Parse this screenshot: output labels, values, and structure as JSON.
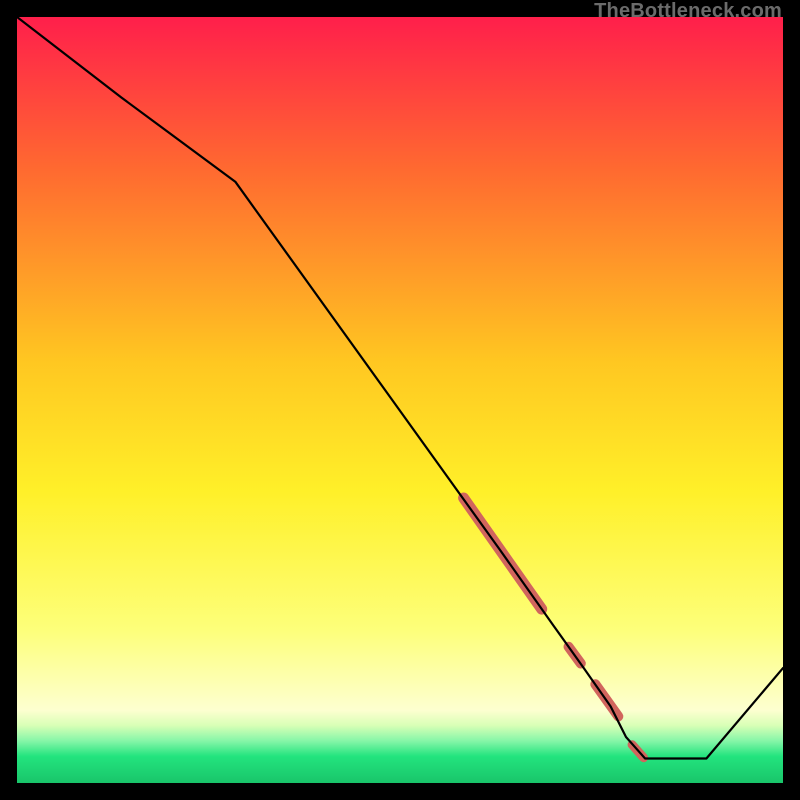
{
  "watermark": "TheBottleneck.com",
  "chart_data": {
    "type": "line",
    "title": "",
    "xlabel": "",
    "ylabel": "",
    "xlim": [
      0,
      100
    ],
    "ylim": [
      0,
      100
    ],
    "gradient_stops": [
      {
        "offset": 0.0,
        "color": "#ff1f4b"
      },
      {
        "offset": 0.2,
        "color": "#ff6a30"
      },
      {
        "offset": 0.45,
        "color": "#ffc721"
      },
      {
        "offset": 0.62,
        "color": "#fff029"
      },
      {
        "offset": 0.8,
        "color": "#fdff7a"
      },
      {
        "offset": 0.905,
        "color": "#fdffd0"
      },
      {
        "offset": 0.925,
        "color": "#d8ffb6"
      },
      {
        "offset": 0.945,
        "color": "#86f6a8"
      },
      {
        "offset": 0.965,
        "color": "#23e47e"
      },
      {
        "offset": 1.0,
        "color": "#19c56a"
      }
    ],
    "series": [
      {
        "name": "bottleneck-curve",
        "x": [
          0.0,
          13.6,
          28.5,
          63.0,
          70.0,
          74.0,
          77.5,
          79.5,
          82.0,
          90.0,
          100.0
        ],
        "y": [
          100.0,
          89.5,
          78.5,
          30.5,
          20.6,
          15.0,
          10.0,
          6.0,
          3.2,
          3.2,
          15.0
        ]
      }
    ],
    "highlights": [
      {
        "x1": 58.3,
        "y1": 37.2,
        "x2": 68.5,
        "y2": 22.7,
        "width": 11
      },
      {
        "x1": 72.0,
        "y1": 17.8,
        "x2": 73.6,
        "y2": 15.6,
        "width": 10
      },
      {
        "x1": 75.5,
        "y1": 12.9,
        "x2": 78.5,
        "y2": 8.7,
        "width": 10
      },
      {
        "x1": 80.3,
        "y1": 5.0,
        "x2": 81.8,
        "y2": 3.3,
        "width": 9
      }
    ],
    "highlight_color": "#d1655d"
  }
}
